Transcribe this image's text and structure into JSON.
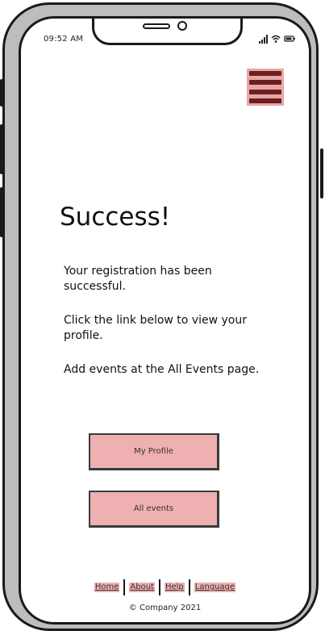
{
  "status_bar": {
    "time": "09:52 AM"
  },
  "menu": {
    "icon": "hamburger-menu-icon"
  },
  "main": {
    "title": "Success!",
    "paragraphs": [
      "Your registration has been successful.",
      "Click the link below to view your profile.",
      "Add events at the All Events page."
    ],
    "buttons": {
      "profile_label": "My Profile",
      "events_label": "All events"
    }
  },
  "footer": {
    "links": [
      "Home",
      "About",
      "Help",
      "Language"
    ],
    "copyright": "© Company 2021"
  },
  "colors": {
    "accent_pink": "#eeb0b0",
    "menu_bar": "#6b1f1f",
    "frame": "#1a1a1a",
    "phone_body": "#bdbdbd"
  }
}
